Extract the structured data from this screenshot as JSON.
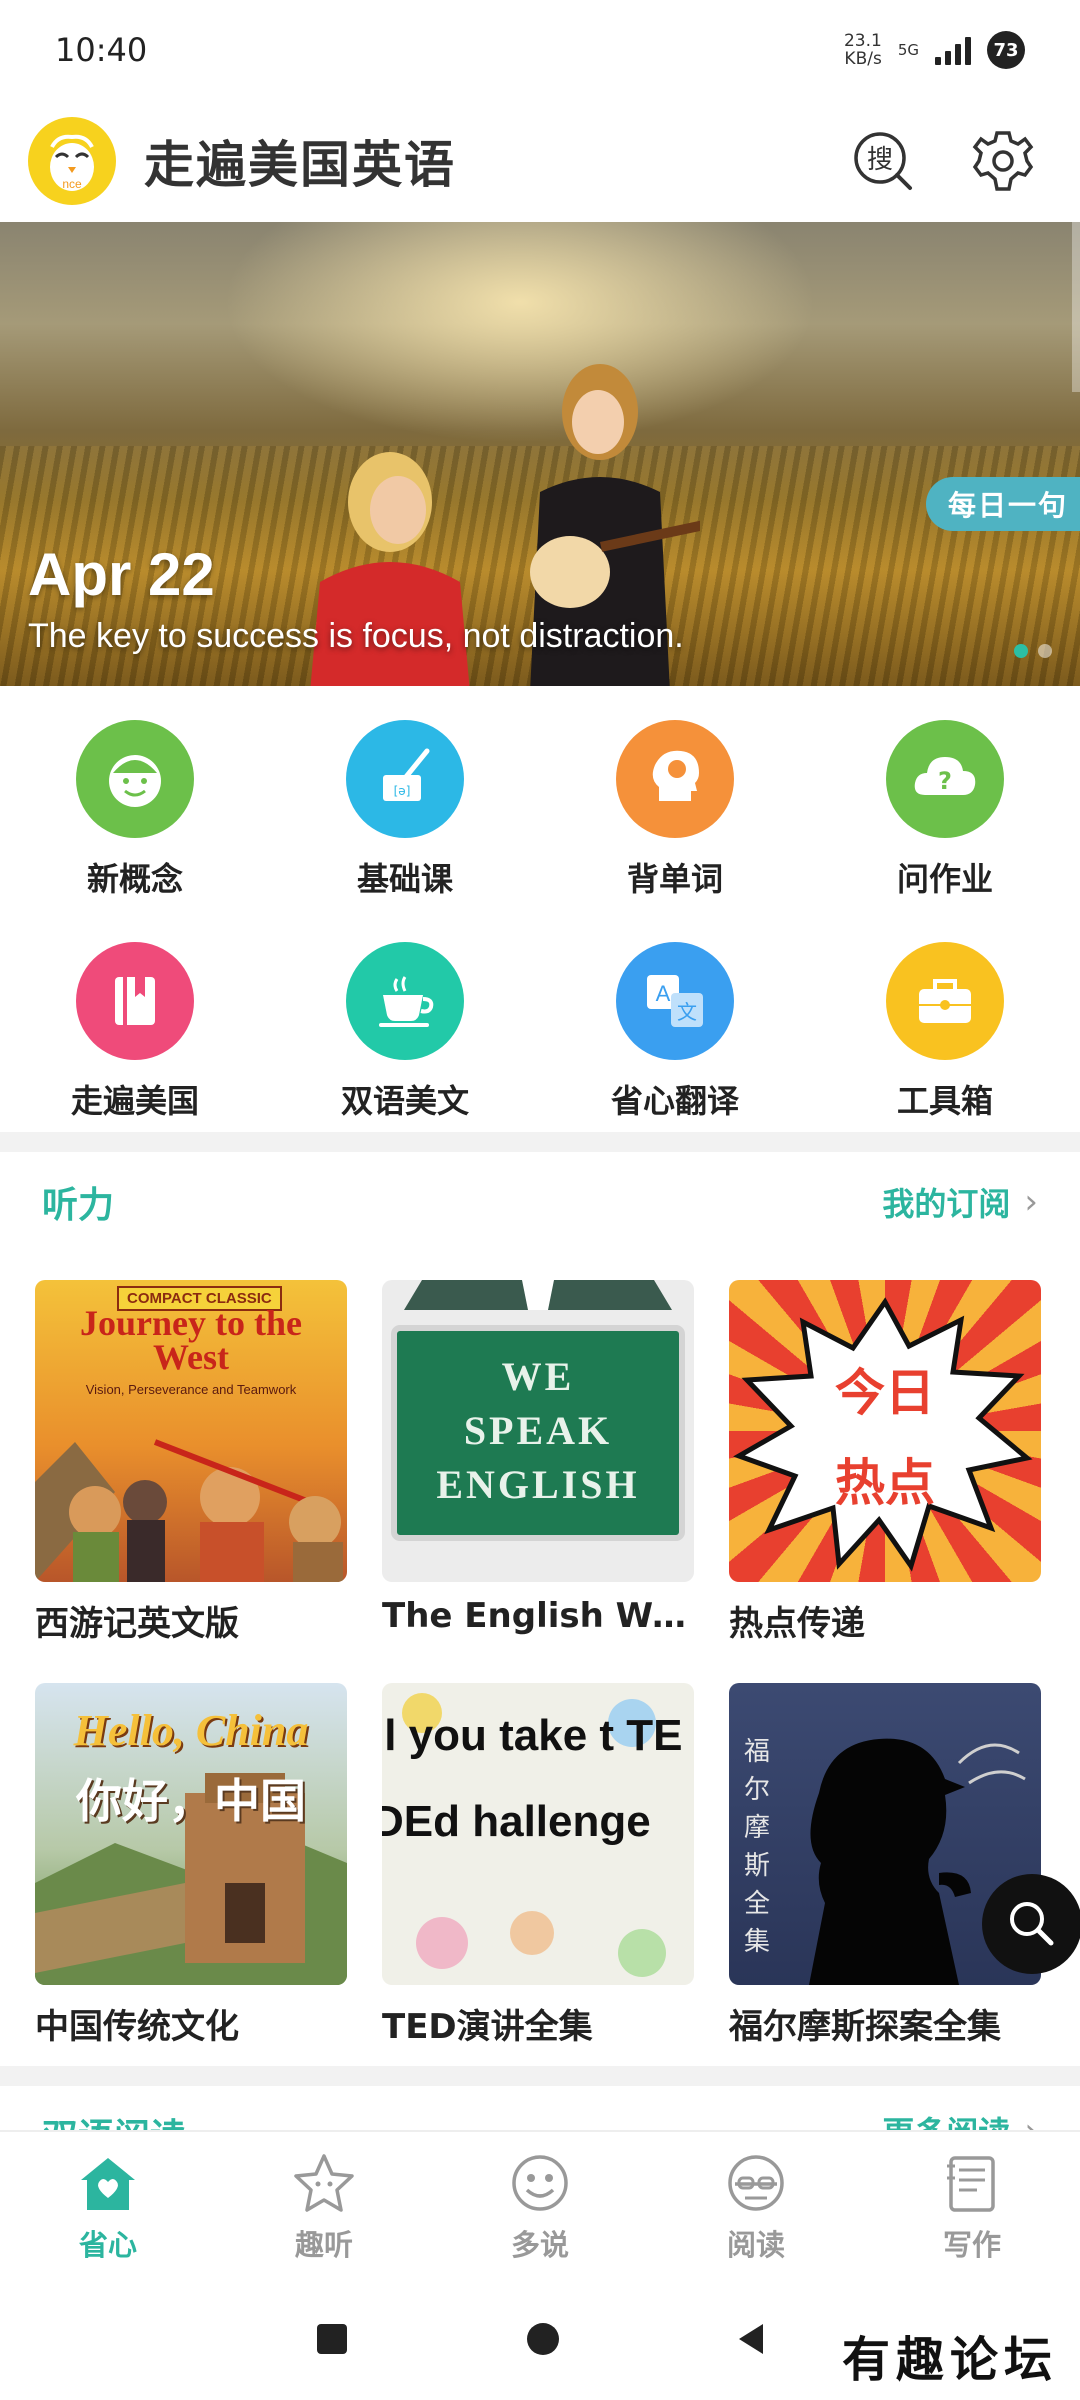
{
  "status_bar": {
    "time": "10:40",
    "net_speed_value": "23.1",
    "net_speed_unit": "KB/s",
    "network": "5G",
    "battery": "73"
  },
  "header": {
    "title": "走遍美国英语",
    "logo_text": "nce",
    "search_label": "搜"
  },
  "banner": {
    "date": "Apr 22",
    "quote": "The key to success is focus, not distraction.",
    "tag": "每日一句"
  },
  "categories": [
    {
      "label": "新概念",
      "color": "#6cc04a",
      "icon": "smiley-face-icon"
    },
    {
      "label": "基础课",
      "color": "#2cb8e6",
      "icon": "paint-brush-icon"
    },
    {
      "label": "背单词",
      "color": "#f5913a",
      "icon": "head-abc-icon"
    },
    {
      "label": "问作业",
      "color": "#6cc04a",
      "icon": "cloud-question-icon"
    },
    {
      "label": "走遍美国",
      "color": "#ef4b7a",
      "icon": "book-icon"
    },
    {
      "label": "双语美文",
      "color": "#22c9a8",
      "icon": "coffee-cup-icon"
    },
    {
      "label": "省心翻译",
      "color": "#3a9ff0",
      "icon": "translate-icon"
    },
    {
      "label": "工具箱",
      "color": "#f9c220",
      "icon": "toolbox-icon"
    }
  ],
  "listening": {
    "title": "听力",
    "more": "我的订阅",
    "items": [
      {
        "title": "西游记英文版",
        "cover_text": "Journey to the West",
        "cover_top": "COMPACT CLASSIC",
        "cover_sub": "Vision, Perseverance and Teamwork"
      },
      {
        "title": "The English We Speak",
        "cover_text": "WE SPEAK ENGLISH"
      },
      {
        "title": "热点传递",
        "cover_text": "今日 热点"
      },
      {
        "title": "中国传统文化",
        "cover_text": "Hello, China",
        "cover_sub": "你好，中国"
      },
      {
        "title": "TED演讲全集",
        "cover_text": "ll you take t TEDEd hallenge"
      },
      {
        "title": "福尔摩斯探案全集",
        "cover_text": "福尔摩斯全集"
      }
    ]
  },
  "next_section": {
    "title": "双语阅读",
    "more": "更多阅读"
  },
  "bottom_nav": [
    {
      "label": "省心",
      "active": true
    },
    {
      "label": "趣听",
      "active": false
    },
    {
      "label": "多说",
      "active": false
    },
    {
      "label": "阅读",
      "active": false
    },
    {
      "label": "写作",
      "active": false
    }
  ],
  "watermark": "有趣论坛",
  "colors": {
    "accent": "#2cb59f",
    "inactive": "#999999"
  }
}
